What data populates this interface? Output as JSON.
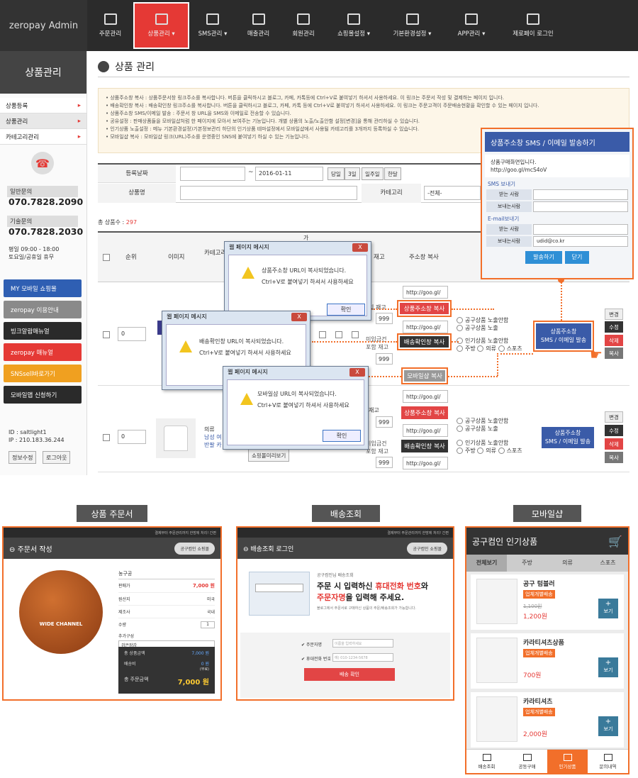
{
  "brand": {
    "logo": "zeropay Admin"
  },
  "nav": [
    {
      "label": "주문관리",
      "icon": "monitor-icon"
    },
    {
      "label": "상품관리 ▾",
      "icon": "basket-icon"
    },
    {
      "label": "SMS관리 ▾",
      "icon": "chat-icon"
    },
    {
      "label": "매출관리",
      "icon": "chart-icon"
    },
    {
      "label": "회원관리",
      "icon": "users-icon"
    },
    {
      "label": "쇼핑몰설정 ▾",
      "icon": "cart-icon"
    },
    {
      "label": "기본환경설정 ▾",
      "icon": "gear-icon"
    },
    {
      "label": "APP관리 ▾",
      "icon": "phone-icon"
    },
    {
      "label": "제로페이 로그인",
      "icon": "power-icon"
    }
  ],
  "sidebar": {
    "title": "상품관리",
    "items": [
      "상품등록",
      "상품관리",
      "카테고리관리"
    ],
    "general_label": "일반문의",
    "general_phone": "070.7828.2090",
    "tech_label": "기술문의",
    "tech_phone": "070.7828.2030",
    "hours1": "평일 09:00 - 18:00",
    "hours2": "토요일/공휴일 휴무",
    "buttons": [
      {
        "label": "MY 모바일 쇼핑몰",
        "color": "#2f5fb3"
      },
      {
        "label": "zeropay 이용안내",
        "color": "#8a8a8a"
      },
      {
        "label": "빙크알람매뉴얼",
        "color": "#2a2a2a"
      },
      {
        "label": "zeropay 매뉴얼",
        "color": "#e53935"
      },
      {
        "label": "SNSsell바로가기",
        "color": "#f0a020"
      },
      {
        "label": "모바일앱 신청하기",
        "color": "#2a2a2a"
      }
    ],
    "id": "ID : saltlight1",
    "ip": "IP : 210.183.36.244",
    "edit_btn": "정보수정",
    "logout_btn": "로그아웃"
  },
  "page": {
    "title": "상품 관리",
    "notice": [
      "상품주소창 복사 : 상품주문서창 링크주소를 복사합니다. 버튼을 클릭하시고 블로그, 카페, 카톡등에 Ctrl+V로 붙여넣기 하셔서 사용하세요. 이 링크는 주문서 작성 및 결제하는 페이지 입니다.",
      "배송확인창 복사 : 배송확인창 링크주소를 복사합니다. 버튼을 클릭하시고 블로그, 카페, 카톡 등에 Ctrl+V로 붙여넣기 하셔서 사용하세요. 이 링크는 주문고객이 주문배송현황을 확인할 수 있는 페이지 입니다.",
      "상품주소창 SMS/이메일 발송 : 주문서 창 URL을 SMS와 이메일로 전송할 수 있습니다.",
      "공유설정 : 판매상품들을 모바일샵처럼 한 페이지에 모아서 보여주는 기능입니다. 개별 상품의 노출/노출안함 설정[변경]을 통해 관리하실 수 있습니다.",
      "인기상품 노출설정 : 메뉴 기본환경설정)기본정보관리 하단의 인기상품 테마설정에서 모바일샵에서 사용될 카테고리를 3개까지 등록하실 수 있습니다.",
      "모바일샵 복사 : 모바일샵 링크(URL)주소를 운영중인 SNS에 붙여넣기 하실 수 있는 기능입니다."
    ],
    "form": {
      "date_label": "등록날짜",
      "date_to": "2016-01-11",
      "range_sep": "~",
      "quick": [
        "당일",
        "3일",
        "일주일",
        "한달"
      ],
      "name_label": "상품명",
      "category_label": "카테고리",
      "category_value": "-전체-"
    },
    "total_label": "총 상품수 :",
    "total_value": "297",
    "headers": [
      "순위",
      "이미지",
      "카테고리/상품명",
      "가",
      "재고",
      "주소창 복사"
    ]
  },
  "rows": [
    {
      "rank": "0",
      "stock1": "999",
      "stock2": "999",
      "url": "http://goo.gl/",
      "copy_order": "상품주소창 복사",
      "copy_ship": "배송확인창 복사",
      "copy_mobile": "모바일샵 복사",
      "opt1": "공구상품 노출안함",
      "opt2": "공구상품 노출",
      "opt3": "인기상품 노출안함",
      "opt4a": "주방",
      "opt4b": "의류",
      "opt4c": "스포츠",
      "send": "상품주소창\nSMS / 이메일 발송",
      "act": [
        "변경",
        "수정",
        "삭제",
        "복사"
      ],
      "stock_label": "미입금건",
      "stock_label2": "포함 재고",
      "stock_label0": "입 재고"
    },
    {
      "rank": "0",
      "category": "의류",
      "name1": "남성 여",
      "name2": "반팔 카",
      "stock1": "999",
      "stock2": "999",
      "url": "http://goo.gl/",
      "copy_order": "상품주소창 복사",
      "copy_ship": "배송확인창 복사",
      "preview": "쇼핑몰미리보기",
      "opt1": "공구상품 노출안함",
      "opt2": "공구상품 노출",
      "opt3": "인기상품 노출안함",
      "opt4a": "주방",
      "opt4b": "의류",
      "opt4c": "스포츠",
      "send": "상품주소창\nSMS / 이메일 발송",
      "act": [
        "변경",
        "수정",
        "삭제",
        "복사"
      ],
      "stock_label": "미입금건",
      "stock_label2": "포함 재고",
      "stock_label0": "재고"
    }
  ],
  "dialogs": [
    {
      "title": "웹 페이지 메시지",
      "line1": "상품주소창 URL이 복사되었습니다.",
      "line2": "Ctrl+V로 붙여넣기 하셔서 사용하세요",
      "ok": "확인",
      "x": "X"
    },
    {
      "title": "웹 페이지 메시지",
      "line1": "배송확인창 URL이 복사되었습니다.",
      "line2": "Ctrl+V로 붙여넣기 하셔서 사용하세요",
      "ok": "확인",
      "x": "X"
    },
    {
      "title": "웹 페이지 메시지",
      "line1": "모바일샵 URL이 복사되었습니다.",
      "line2": "Ctrl+V로 붙여넣기 하셔서 사용하세요",
      "ok": "확인",
      "x": "X"
    }
  ],
  "sms": {
    "title": "상품주소창 SMS / 이메일 발송하기",
    "msg1": "상품구매화면입니다.",
    "msg2": "http://goo.gl/mcS4oV",
    "sms_label": "SMS 보내기",
    "recv": "받는 사람",
    "send": "보내는사람",
    "email_label": "E-mail보내기",
    "email_value": "udid@co.kr",
    "send_btn": "발송하기",
    "close_btn": "닫기"
  },
  "captions": [
    "상품 주문서",
    "배송조회",
    "모바일샵"
  ],
  "order": {
    "topline": "결제부터 주문관리까지 한방에 처리! 간편",
    "title": "주문서 작성",
    "badge": "공구컴인 쇼핑몰",
    "cat": "농구공",
    "rows": [
      [
        "판매가",
        "7,000 원"
      ],
      [
        "원산지",
        "미국"
      ],
      [
        "제조사",
        "국내"
      ]
    ],
    "qty_label": "수량",
    "qty": "1",
    "option_label": "추가구성",
    "option_value": "검은장갑",
    "sum1_label": "총 상품금액",
    "sum1": "7,000 원",
    "ship_label": "배송비",
    "ship": "0 원",
    "ship_note": "(무료)",
    "total_label": "총 주문금액",
    "total": "7,000 원",
    "ball_text": "WIDE CHANNEL"
  },
  "ship": {
    "topline": "결제부터 주문관리까지 한방에 처리! 간편",
    "title": "배송조회 로그인",
    "badge": "공구컴인 쇼핑몰",
    "greet": "공구컴인님 배송조회",
    "h1a": "주문 시 입력하신 ",
    "h1b": "휴대전화 번호",
    "h1c": "와",
    "h2a": "주문자명",
    "h2b": "을 입력해 주세요.",
    "desc": "블로그에서 주문서로 구매하신 상품의 주문/배송조회가 가능합니다.",
    "name_label": "주문자명",
    "name_ph": "이름을 입력하세요",
    "phone_label": "휴대전화 번호",
    "phone_ph": "예) 010-1234-5678",
    "btn": "배송 확인"
  },
  "mobile": {
    "title": "공구컴인 인기상품",
    "tabs": [
      "전체보기",
      "주방",
      "의류",
      "스포츠"
    ],
    "items": [
      {
        "name": "공구 텀블러",
        "badge": "업체개별배송",
        "old": "1,100원",
        "price": "1,200원"
      },
      {
        "name": "카라티셔츠상품",
        "badge": "업체개별배송",
        "old": "",
        "price": "700원"
      },
      {
        "name": "카라티셔츠",
        "badge": "업체개별배송",
        "old": "",
        "price": "2,000원"
      }
    ],
    "view": "보기",
    "bottom": [
      "배송조회",
      "공동구매",
      "인기상품",
      "문의내역"
    ]
  }
}
